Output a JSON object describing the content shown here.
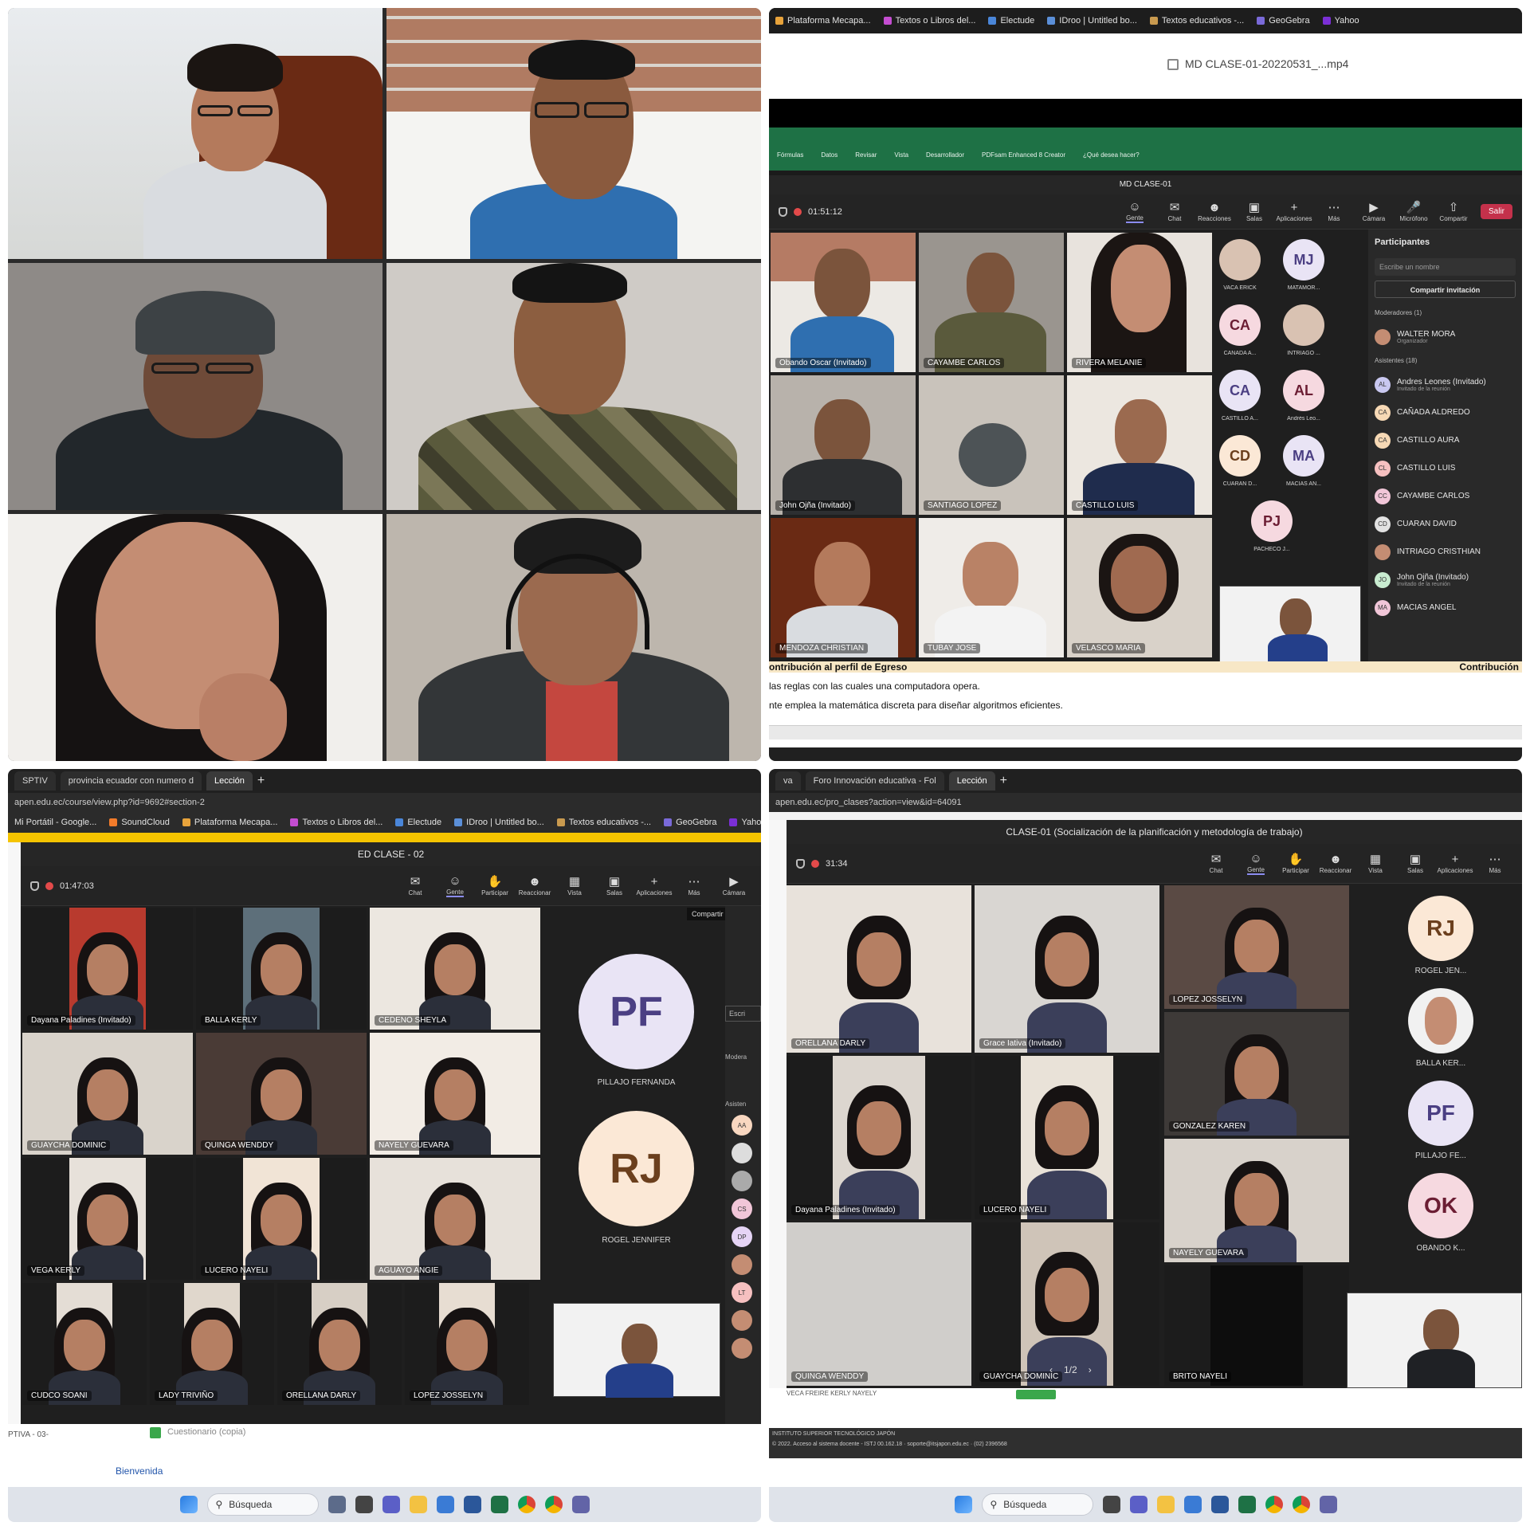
{
  "q2": {
    "bookmarks": [
      "Plataforma Mecapa...",
      "Textos o Libros del...",
      "Electude",
      "IDroo | Untitled bo...",
      "Textos educativos -...",
      "GeoGebra",
      "Yahoo"
    ],
    "video_file": "MD CLASE-01-20220531_...mp4",
    "excel_tabs": [
      "Fórmulas",
      "Datos",
      "Revisar",
      "Vista",
      "Desarrollador",
      "PDFsam Enhanced 8 Creator",
      "¿Qué desea hacer?"
    ],
    "meeting_title": "MD CLASE-01",
    "timer": "01:51:12",
    "tools": [
      "Gente",
      "Chat",
      "Reacciones",
      "Salas",
      "Aplicaciones",
      "Más",
      "Cámara",
      "Micrófono",
      "Compartir"
    ],
    "leave": "Salir",
    "tiles": [
      "Obando Oscar (Invitado)",
      "CAYAMBE CARLOS",
      "RIVERA MELANIE",
      "John Ojña (Invitado)",
      "SANTIAGO LOPEZ",
      "CASTILLO LUIS",
      "MENDOZA CHRISTIAN",
      "TUBAY JOSE",
      "VELASCO MARIA"
    ],
    "avatars": [
      {
        "initials": "",
        "name": "VACA ERICK"
      },
      {
        "initials": "MJ",
        "name": "MATAMOR..."
      },
      {
        "initials": "CA",
        "name": "CAÑADA A..."
      },
      {
        "initials": "",
        "name": "INTRIAGO ..."
      },
      {
        "initials": "CA",
        "name": "CASTILLO A..."
      },
      {
        "initials": "AL",
        "name": "Andrés Leo..."
      },
      {
        "initials": "CD",
        "name": "CUARAN D..."
      },
      {
        "initials": "MA",
        "name": "MACIAS AN..."
      },
      {
        "initials": "PJ",
        "name": "PACHECO J..."
      }
    ],
    "panel": {
      "title": "Participantes",
      "search_placeholder": "Escribe un nombre",
      "share_label": "Compartir invitación",
      "moderators_header": "Moderadores (1)",
      "moderator_name": "WALTER MORA",
      "moderator_role": "Organizador",
      "attendees_header": "Asistentes (18)",
      "attendees": [
        {
          "initials": "AL",
          "name": "Andres Leones (Invitado)",
          "sub": "Invitado de la reunión"
        },
        {
          "initials": "CA",
          "name": "CAÑADA ALDREDO",
          "sub": ""
        },
        {
          "initials": "CA",
          "name": "CASTILLO AURA",
          "sub": ""
        },
        {
          "initials": "CL",
          "name": "CASTILLO LUIS",
          "sub": ""
        },
        {
          "initials": "CC",
          "name": "CAYAMBE CARLOS",
          "sub": ""
        },
        {
          "initials": "CD",
          "name": "CUARAN DAVID",
          "sub": ""
        },
        {
          "initials": "",
          "name": "INTRIAGO CRISTHIAN",
          "sub": ""
        },
        {
          "initials": "JO",
          "name": "John Ojña (Invitado)",
          "sub": "Invitado de la reunión"
        },
        {
          "initials": "MA",
          "name": "MACIAS ANGEL",
          "sub": ""
        }
      ]
    },
    "excel_row1": "ontribución al perfil de Egreso",
    "excel_row1_right": "Contribución",
    "excel_row2": "las reglas con las cuales una computadora opera.",
    "excel_row3": "nte emplea la matemática discreta para diseñar algoritmos eficientes."
  },
  "q3": {
    "tabs": [
      "SPTIV",
      "provincia ecuador con numero d",
      "Lección"
    ],
    "address": "apen.edu.ec/course/view.php?id=9692#section-2",
    "bookmarks": [
      "Mi Portátil - Google...",
      "SoundCloud",
      "Plataforma Mecapa...",
      "Textos o Libros del...",
      "Electude",
      "IDroo | Untitled bo...",
      "Textos educativos -...",
      "GeoGebra",
      "Yahoo"
    ],
    "meeting_title": "ED CLASE - 02",
    "timer": "01:47:03",
    "tools": [
      "Chat",
      "Gente",
      "Participar",
      "Reaccionar",
      "Vista",
      "Salas",
      "Aplicaciones",
      "Más",
      "Cámara"
    ],
    "tooltip": "Compartir contenido",
    "tiles": [
      "Dayana Paladines (Invitado)",
      "BALLA KERLY",
      "CEDENO SHEYLA",
      "GUAYCHA DOMINIC",
      "QUINGA WENDDY",
      "NAYELY GUEVARA",
      "VEGA KERLY",
      "LUCERO NAYELI",
      "AGUAYO ANGIE",
      "CUDCO SOANI",
      "LADY TRIVIÑO",
      "ORELLANA DARLY",
      "LOPEZ JOSSELYN"
    ],
    "avatars": [
      {
        "initials": "PF",
        "name": "PILLAJO FERNANDA"
      },
      {
        "initials": "RJ",
        "name": "ROGEL JENNIFER"
      }
    ],
    "side_labels": [
      "Escri",
      "Modera",
      "Asisten"
    ],
    "side_avatars": [
      "AA",
      "",
      "",
      "CS",
      "DP",
      "",
      "LT",
      "",
      ""
    ],
    "page_label": "PTIVA - 03-",
    "page_item": "Cuestionario (copia)",
    "welcome": "Bienvenida",
    "search": "Búsqueda"
  },
  "q4": {
    "tabs": [
      "va",
      "Foro Innovación educativa - Fol",
      "Lección"
    ],
    "address": "apen.edu.ec/pro_clases?action=view&id=64091",
    "meeting_title": "CLASE-01 (Socialización de la planificación y metodología de trabajo)",
    "timer": "31:34",
    "tools": [
      "Chat",
      "Gente",
      "Participar",
      "Reaccionar",
      "Vista",
      "Salas",
      "Aplicaciones",
      "Más"
    ],
    "tiles": [
      "ORELLANA DARLY",
      "Grace Iativa (Invitado)",
      "LOPEZ JOSSELYN",
      "Dayana Paladines (Invitado)",
      "LUCERO NAYELI",
      "GONZALEZ KAREN",
      "QUINGA WENDDY",
      "GUAYCHA DOMINIC",
      "NAYELY GUEVARA",
      "BRITO NAYELI"
    ],
    "avatars": [
      {
        "initials": "RJ",
        "name": "ROGEL JEN..."
      },
      {
        "initials": "",
        "name": "BALLA KER..."
      },
      {
        "initials": "PF",
        "name": "PILLAJO FE..."
      },
      {
        "initials": "OK",
        "name": "OBANDO K..."
      }
    ],
    "pager": "1/2",
    "bottom_row": "VECA FREIRE KERLY NAYELY",
    "footer1": "INSTITUTO SUPERIOR TECNOLÓGICO JAPÓN",
    "footer2": "© 2022. Acceso al sistema docente - ISTJ 00.162.18 · soporte@itsjapon.edu.ec · (02) 2396568",
    "search": "Búsqueda"
  }
}
